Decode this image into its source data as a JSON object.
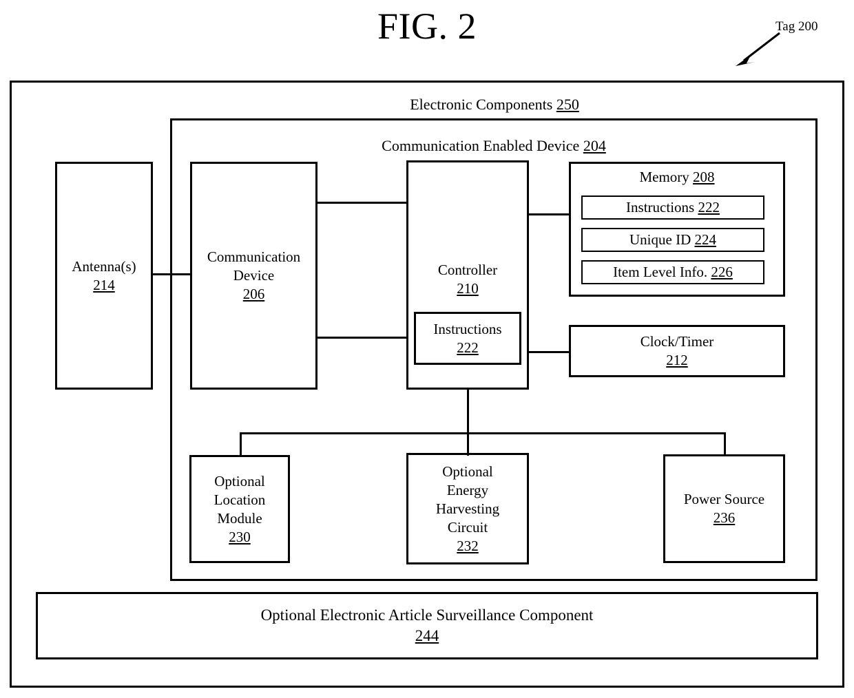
{
  "figure": {
    "title": "FIG. 2",
    "callout": {
      "label": "Tag 200",
      "arrow_icon": "arrow-down-left-icon"
    }
  },
  "diagram": {
    "outer_container": {
      "name": "Tag",
      "ref": "200"
    },
    "electronic_components": {
      "caption": "Electronic Components ",
      "ref": "250"
    },
    "communication_enabled_device": {
      "caption": "Communication Enabled Device ",
      "ref": "204"
    },
    "blocks": {
      "antenna": {
        "label": "Antenna(s)",
        "ref": "214"
      },
      "communication_device": {
        "label": "Communication\nDevice",
        "ref": "206"
      },
      "controller": {
        "label": "Controller",
        "ref": "210"
      },
      "controller_instructions": {
        "label": "Instructions",
        "ref": "222"
      },
      "memory": {
        "label": "Memory ",
        "ref": "208"
      },
      "memory_instructions": {
        "label": "Instructions  ",
        "ref": "222"
      },
      "memory_unique_id": {
        "label": "Unique ID  ",
        "ref": "224"
      },
      "memory_item_level_info": {
        "label": "Item Level Info.  ",
        "ref": "226"
      },
      "clock_timer": {
        "label": "Clock/Timer",
        "ref": "212"
      },
      "optional_location_module": {
        "label": "Optional\nLocation\nModule",
        "ref": "230"
      },
      "optional_energy_harvesting_circuit": {
        "label": "Optional\nEnergy\nHarvesting\nCircuit",
        "ref": "232"
      },
      "power_source": {
        "label": "Power Source",
        "ref": "236"
      },
      "optional_eas_component": {
        "label": "Optional Electronic Article Surveillance Component",
        "ref": "244"
      }
    },
    "colors": {
      "stroke": "#000000",
      "background": "#ffffff"
    }
  }
}
